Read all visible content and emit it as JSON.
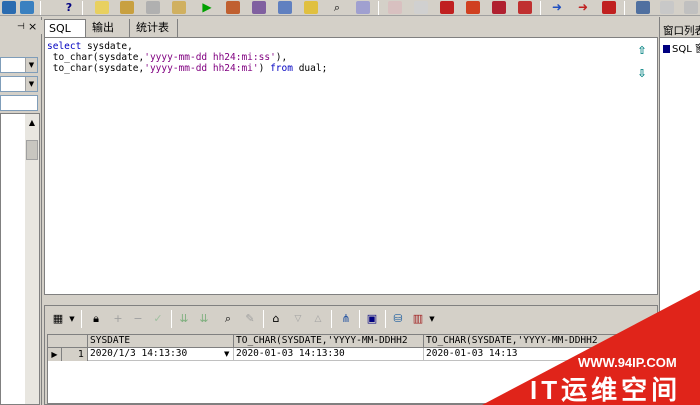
{
  "colors": {
    "toolbar_bg": "#d4d0c8",
    "keyword": "#0000c0",
    "string": "#800080",
    "watermark_red": "#e0241a"
  },
  "left_panel": {
    "pin_icon": "pin-icon",
    "close_label": "×"
  },
  "tabs": [
    {
      "label": "SQL",
      "active": true
    },
    {
      "label": "输出",
      "active": false
    },
    {
      "label": "统计表",
      "active": false
    }
  ],
  "editor": {
    "lines": [
      {
        "kw": "select",
        "rest": " sysdate,"
      },
      {
        "prefix": " to_char(sysdate,",
        "str": "'yyyy-mm-dd hh24:mi:ss'",
        "suffix": "),"
      },
      {
        "prefix": " to_char(sysdate,",
        "str": "'yyyy-mm-dd hh24:mi'",
        "suffix": ") ",
        "kw2": "from",
        "tail": " dual;"
      }
    ]
  },
  "result": {
    "columns": [
      "SYSDATE",
      "TO_CHAR(SYSDATE,'YYYY-MM-DDHH2",
      "TO_CHAR(SYSDATE,'YYYY-MM-DDHH2"
    ],
    "rows": [
      {
        "num": "1",
        "cells": [
          "2020/1/3 14:13:30",
          "2020-01-03 14:13:30",
          "2020-01-03 14:13"
        ]
      }
    ]
  },
  "right_panel": {
    "title": "窗口列表",
    "item": "SQL 窗"
  },
  "watermark": {
    "url": "WWW.94IP.COM",
    "text": "IT运维空间"
  }
}
